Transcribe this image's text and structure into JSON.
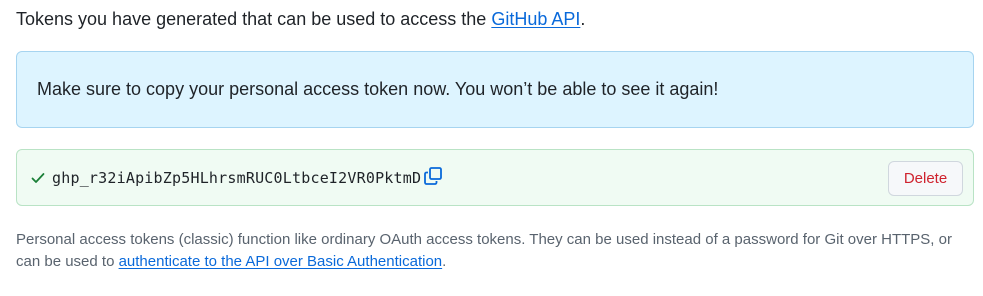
{
  "intro": {
    "text_before": "Tokens you have generated that can be used to access the ",
    "link_label": "GitHub API",
    "text_after": "."
  },
  "flash": {
    "message": "Make sure to copy your personal access token now. You won’t be able to see it again!"
  },
  "token": {
    "value": "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",
    "delete_label": "Delete",
    "check_icon": "check-icon",
    "copy_icon": "copy-icon"
  },
  "note": {
    "text_before": "Personal access tokens (classic) function like ordinary OAuth access tokens. They can be used instead of a password for Git over HTTPS, or can be used to ",
    "link_label": "authenticate to the API over Basic Authentication",
    "text_after": "."
  },
  "colors": {
    "link": "#0969da",
    "flash_bg": "#ddf4ff",
    "token_bg": "#f0fbf3",
    "success": "#1a7f37",
    "danger": "#cf222e"
  }
}
